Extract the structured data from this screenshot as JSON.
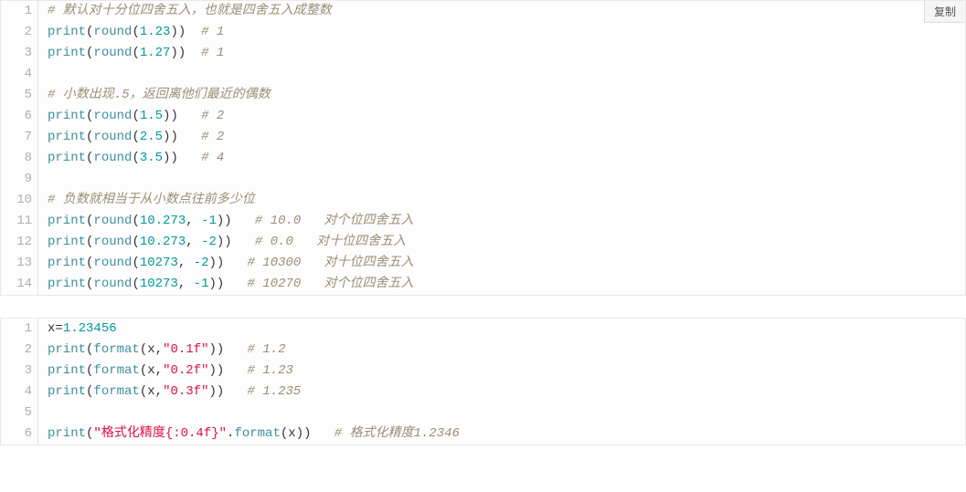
{
  "copy_button_label": "复制",
  "blocks": [
    {
      "show_copy": true,
      "lines": [
        {
          "n": "1",
          "tokens": [
            {
              "t": "# 默认对十分位四舍五入，也就是四舍五入成整数",
              "c": "tok-comment"
            }
          ]
        },
        {
          "n": "2",
          "tokens": [
            {
              "t": "print",
              "c": "tok-func"
            },
            {
              "t": "(",
              "c": "tok-punct"
            },
            {
              "t": "round",
              "c": "tok-builtin"
            },
            {
              "t": "(",
              "c": "tok-punct"
            },
            {
              "t": "1.23",
              "c": "tok-num"
            },
            {
              "t": "))  ",
              "c": "tok-punct"
            },
            {
              "t": "# 1",
              "c": "tok-comment"
            }
          ]
        },
        {
          "n": "3",
          "tokens": [
            {
              "t": "print",
              "c": "tok-func"
            },
            {
              "t": "(",
              "c": "tok-punct"
            },
            {
              "t": "round",
              "c": "tok-builtin"
            },
            {
              "t": "(",
              "c": "tok-punct"
            },
            {
              "t": "1.27",
              "c": "tok-num"
            },
            {
              "t": "))  ",
              "c": "tok-punct"
            },
            {
              "t": "# 1",
              "c": "tok-comment"
            }
          ]
        },
        {
          "n": "4",
          "tokens": []
        },
        {
          "n": "5",
          "tokens": [
            {
              "t": "# 小数出现.5，返回离他们最近的偶数",
              "c": "tok-comment"
            }
          ]
        },
        {
          "n": "6",
          "tokens": [
            {
              "t": "print",
              "c": "tok-func"
            },
            {
              "t": "(",
              "c": "tok-punct"
            },
            {
              "t": "round",
              "c": "tok-builtin"
            },
            {
              "t": "(",
              "c": "tok-punct"
            },
            {
              "t": "1.5",
              "c": "tok-num"
            },
            {
              "t": "))   ",
              "c": "tok-punct"
            },
            {
              "t": "# 2",
              "c": "tok-comment"
            }
          ]
        },
        {
          "n": "7",
          "tokens": [
            {
              "t": "print",
              "c": "tok-func"
            },
            {
              "t": "(",
              "c": "tok-punct"
            },
            {
              "t": "round",
              "c": "tok-builtin"
            },
            {
              "t": "(",
              "c": "tok-punct"
            },
            {
              "t": "2.5",
              "c": "tok-num"
            },
            {
              "t": "))   ",
              "c": "tok-punct"
            },
            {
              "t": "# 2",
              "c": "tok-comment"
            }
          ]
        },
        {
          "n": "8",
          "tokens": [
            {
              "t": "print",
              "c": "tok-func"
            },
            {
              "t": "(",
              "c": "tok-punct"
            },
            {
              "t": "round",
              "c": "tok-builtin"
            },
            {
              "t": "(",
              "c": "tok-punct"
            },
            {
              "t": "3.5",
              "c": "tok-num"
            },
            {
              "t": "))   ",
              "c": "tok-punct"
            },
            {
              "t": "# 4",
              "c": "tok-comment"
            }
          ]
        },
        {
          "n": "9",
          "tokens": []
        },
        {
          "n": "10",
          "tokens": [
            {
              "t": "# 负数就相当于从小数点往前多少位",
              "c": "tok-comment"
            }
          ]
        },
        {
          "n": "11",
          "tokens": [
            {
              "t": "print",
              "c": "tok-func"
            },
            {
              "t": "(",
              "c": "tok-punct"
            },
            {
              "t": "round",
              "c": "tok-builtin"
            },
            {
              "t": "(",
              "c": "tok-punct"
            },
            {
              "t": "10.273",
              "c": "tok-num"
            },
            {
              "t": ", ",
              "c": "tok-punct"
            },
            {
              "t": "-1",
              "c": "tok-num"
            },
            {
              "t": "))   ",
              "c": "tok-punct"
            },
            {
              "t": "# 10.0   对个位四舍五入",
              "c": "tok-comment"
            }
          ]
        },
        {
          "n": "12",
          "tokens": [
            {
              "t": "print",
              "c": "tok-func"
            },
            {
              "t": "(",
              "c": "tok-punct"
            },
            {
              "t": "round",
              "c": "tok-builtin"
            },
            {
              "t": "(",
              "c": "tok-punct"
            },
            {
              "t": "10.273",
              "c": "tok-num"
            },
            {
              "t": ", ",
              "c": "tok-punct"
            },
            {
              "t": "-2",
              "c": "tok-num"
            },
            {
              "t": "))   ",
              "c": "tok-punct"
            },
            {
              "t": "# 0.0   对十位四舍五入",
              "c": "tok-comment"
            }
          ]
        },
        {
          "n": "13",
          "tokens": [
            {
              "t": "print",
              "c": "tok-func"
            },
            {
              "t": "(",
              "c": "tok-punct"
            },
            {
              "t": "round",
              "c": "tok-builtin"
            },
            {
              "t": "(",
              "c": "tok-punct"
            },
            {
              "t": "10273",
              "c": "tok-num"
            },
            {
              "t": ", ",
              "c": "tok-punct"
            },
            {
              "t": "-2",
              "c": "tok-num"
            },
            {
              "t": "))   ",
              "c": "tok-punct"
            },
            {
              "t": "# 10300   对十位四舍五入",
              "c": "tok-comment"
            }
          ]
        },
        {
          "n": "14",
          "tokens": [
            {
              "t": "print",
              "c": "tok-func"
            },
            {
              "t": "(",
              "c": "tok-punct"
            },
            {
              "t": "round",
              "c": "tok-builtin"
            },
            {
              "t": "(",
              "c": "tok-punct"
            },
            {
              "t": "10273",
              "c": "tok-num"
            },
            {
              "t": ", ",
              "c": "tok-punct"
            },
            {
              "t": "-1",
              "c": "tok-num"
            },
            {
              "t": "))   ",
              "c": "tok-punct"
            },
            {
              "t": "# 10270   对个位四舍五入",
              "c": "tok-comment"
            }
          ]
        }
      ]
    },
    {
      "show_copy": false,
      "lines": [
        {
          "n": "1",
          "tokens": [
            {
              "t": "x",
              "c": "tok-ident"
            },
            {
              "t": "=",
              "c": "tok-op"
            },
            {
              "t": "1.23456",
              "c": "tok-num"
            }
          ]
        },
        {
          "n": "2",
          "tokens": [
            {
              "t": "print",
              "c": "tok-func"
            },
            {
              "t": "(",
              "c": "tok-punct"
            },
            {
              "t": "format",
              "c": "tok-builtin"
            },
            {
              "t": "(",
              "c": "tok-punct"
            },
            {
              "t": "x",
              "c": "tok-ident"
            },
            {
              "t": ",",
              "c": "tok-punct"
            },
            {
              "t": "\"0.1f\"",
              "c": "tok-str"
            },
            {
              "t": "))   ",
              "c": "tok-punct"
            },
            {
              "t": "# 1.2",
              "c": "tok-comment"
            }
          ]
        },
        {
          "n": "3",
          "tokens": [
            {
              "t": "print",
              "c": "tok-func"
            },
            {
              "t": "(",
              "c": "tok-punct"
            },
            {
              "t": "format",
              "c": "tok-builtin"
            },
            {
              "t": "(",
              "c": "tok-punct"
            },
            {
              "t": "x",
              "c": "tok-ident"
            },
            {
              "t": ",",
              "c": "tok-punct"
            },
            {
              "t": "\"0.2f\"",
              "c": "tok-str"
            },
            {
              "t": "))   ",
              "c": "tok-punct"
            },
            {
              "t": "# 1.23",
              "c": "tok-comment"
            }
          ]
        },
        {
          "n": "4",
          "tokens": [
            {
              "t": "print",
              "c": "tok-func"
            },
            {
              "t": "(",
              "c": "tok-punct"
            },
            {
              "t": "format",
              "c": "tok-builtin"
            },
            {
              "t": "(",
              "c": "tok-punct"
            },
            {
              "t": "x",
              "c": "tok-ident"
            },
            {
              "t": ",",
              "c": "tok-punct"
            },
            {
              "t": "\"0.3f\"",
              "c": "tok-str"
            },
            {
              "t": "))   ",
              "c": "tok-punct"
            },
            {
              "t": "# 1.235",
              "c": "tok-comment"
            }
          ]
        },
        {
          "n": "5",
          "tokens": []
        },
        {
          "n": "6",
          "tokens": [
            {
              "t": "print",
              "c": "tok-func"
            },
            {
              "t": "(",
              "c": "tok-punct"
            },
            {
              "t": "\"格式化精度{:0.4f}\"",
              "c": "tok-str"
            },
            {
              "t": ".",
              "c": "tok-punct"
            },
            {
              "t": "format",
              "c": "tok-builtin"
            },
            {
              "t": "(",
              "c": "tok-punct"
            },
            {
              "t": "x",
              "c": "tok-ident"
            },
            {
              "t": "))   ",
              "c": "tok-punct"
            },
            {
              "t": "# 格式化精度1.2346",
              "c": "tok-comment"
            }
          ]
        }
      ]
    }
  ]
}
